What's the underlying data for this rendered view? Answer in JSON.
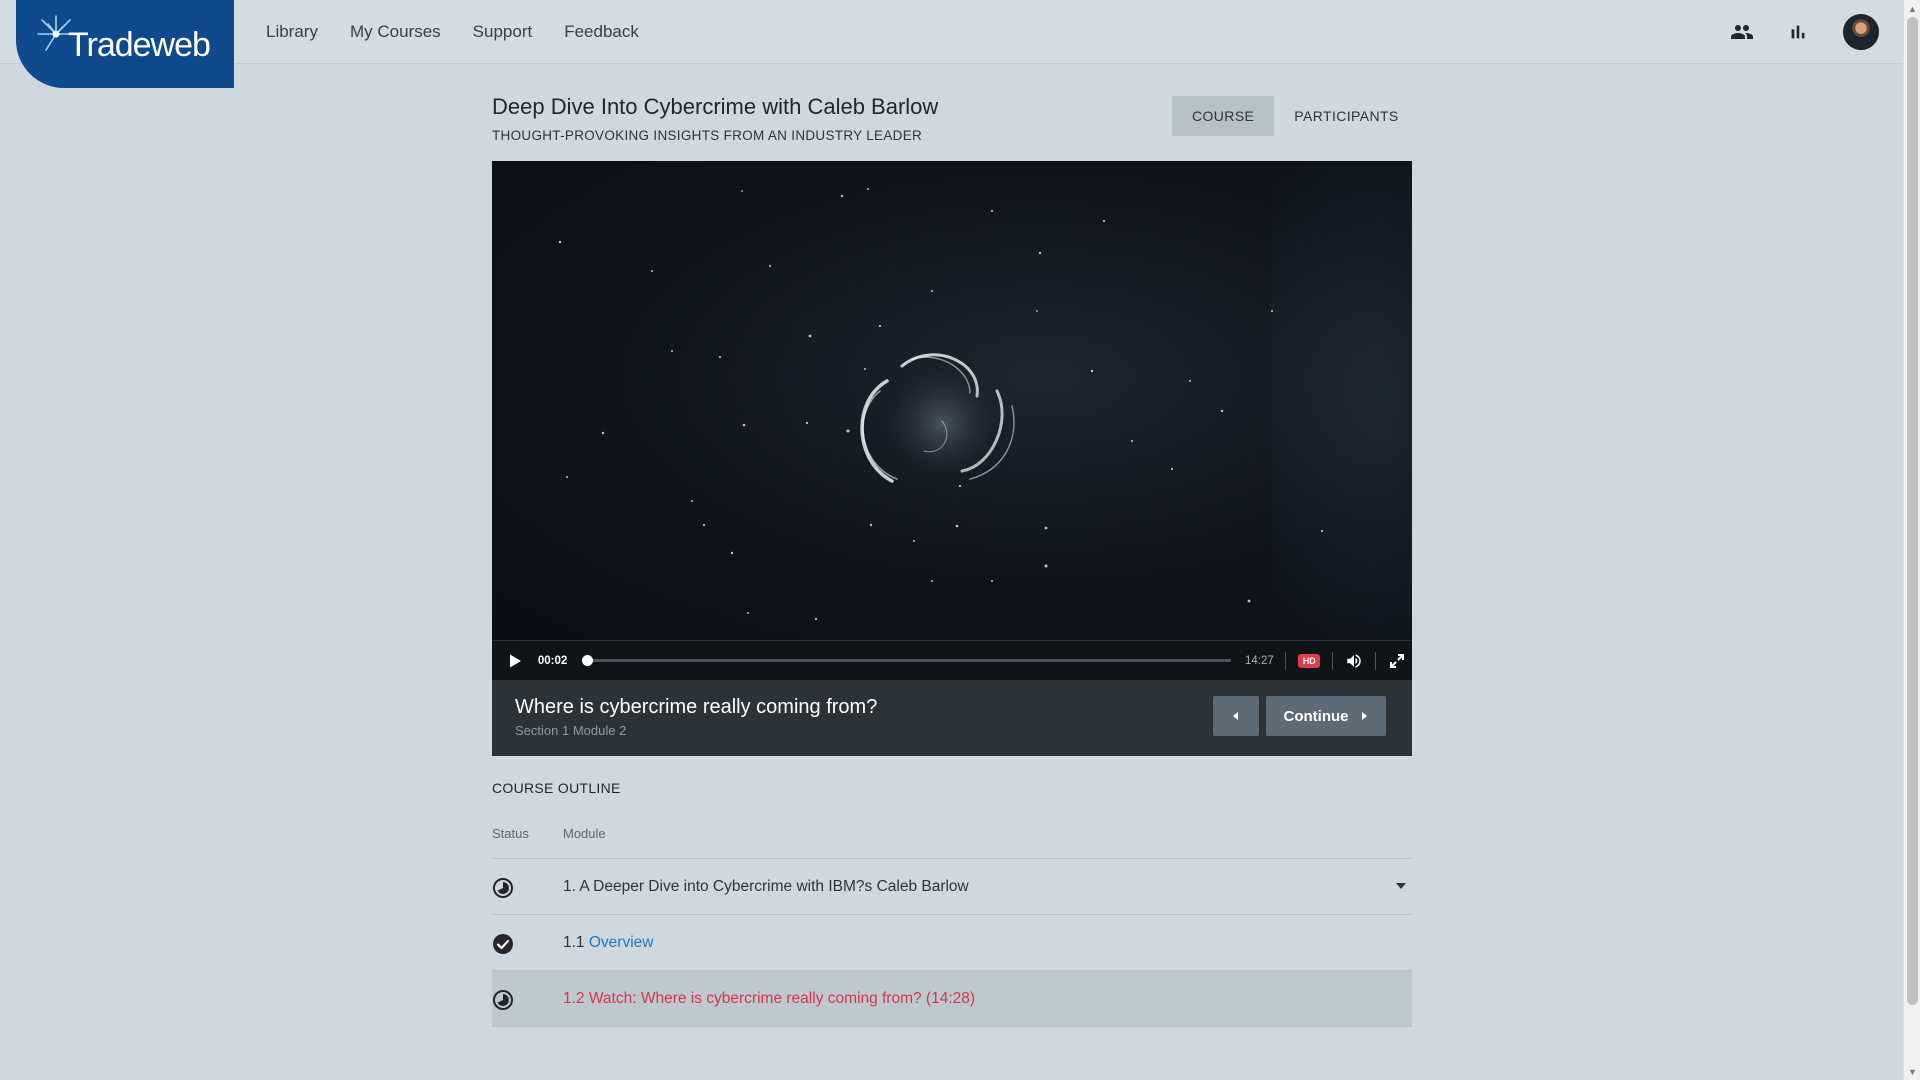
{
  "brand": {
    "logo_text": "Tradeweb",
    "color": "#0e4a8c"
  },
  "nav": {
    "items": [
      {
        "label": "Library"
      },
      {
        "label": "My Courses"
      },
      {
        "label": "Support"
      },
      {
        "label": "Feedback"
      }
    ]
  },
  "header_icons": [
    "people-icon",
    "bar-chart-icon",
    "user-avatar"
  ],
  "course": {
    "title": "Deep Dive Into Cybercrime with Caleb Barlow",
    "subtitle": "THOUGHT-PROVOKING INSIGHTS FROM AN INDUSTRY LEADER",
    "tabs": [
      {
        "label": "COURSE",
        "active": true
      },
      {
        "label": "PARTICIPANTS",
        "active": false
      }
    ]
  },
  "player": {
    "current_time": "00:02",
    "duration": "14:27",
    "progress_fraction": 0.002,
    "hd_label": "HD"
  },
  "module": {
    "title": "Where is cybercrime really coming from?",
    "subtitle": "Section 1 Module 2",
    "continue_label": "Continue"
  },
  "outline": {
    "heading": "COURSE OUTLINE",
    "col_status": "Status",
    "col_module": "Module",
    "rows": [
      {
        "prefix": "1. A Deeper Dive into Cybercrime with IBM?s Caleb Barlow",
        "link": "",
        "status": "in-progress"
      },
      {
        "prefix": "1.1 ",
        "link": "Overview",
        "status": "complete"
      },
      {
        "prefix": "1.2 Watch: Where is cybercrime really coming from? (14:28)",
        "link": "",
        "status": "in-progress"
      }
    ]
  },
  "colors": {
    "accent_link": "#1f78c8",
    "current_module": "#d8344f",
    "hd_badge": "#e23b4e"
  }
}
